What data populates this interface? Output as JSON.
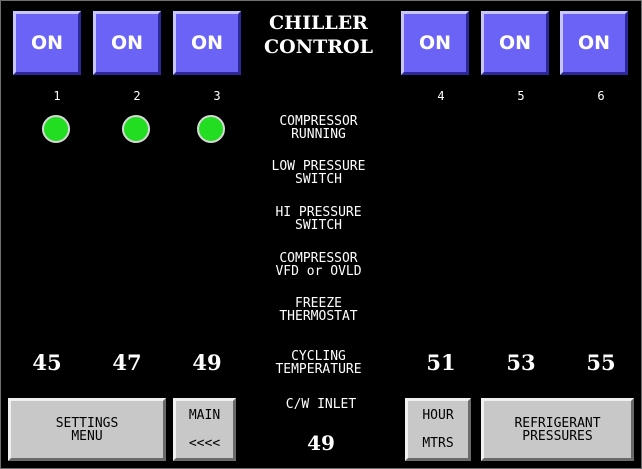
{
  "title_line1": "CHILLER",
  "title_line2": "CONTROL",
  "compressors": [
    {
      "button": "ON",
      "number": "1",
      "running": true,
      "temp": "45"
    },
    {
      "button": "ON",
      "number": "2",
      "running": true,
      "temp": "47"
    },
    {
      "button": "ON",
      "number": "3",
      "running": true,
      "temp": "49"
    },
    {
      "button": "ON",
      "number": "4",
      "running": false,
      "temp": "51"
    },
    {
      "button": "ON",
      "number": "5",
      "running": false,
      "temp": "53"
    },
    {
      "button": "ON",
      "number": "6",
      "running": false,
      "temp": "55"
    }
  ],
  "labels": {
    "compressor_running": [
      "COMPRESSOR",
      "RUNNING"
    ],
    "low_pressure": [
      "LOW PRESSURE",
      "SWITCH"
    ],
    "hi_pressure": [
      "HI PRESSURE",
      "SWITCH"
    ],
    "vfd_ovld": [
      "COMPRESSOR",
      "VFD or OVLD"
    ],
    "freeze": [
      "FREEZE",
      "THERMOSTAT"
    ],
    "cycling": [
      "CYCLING",
      "TEMPERATURE"
    ]
  },
  "cw_inlet": {
    "label": "C/W INLET",
    "value": "49"
  },
  "buttons": {
    "settings": [
      "SETTINGS",
      "MENU"
    ],
    "main": [
      "MAIN",
      "<<<<"
    ],
    "hour": [
      "HOUR",
      "MTRS"
    ],
    "refrigerant": [
      "REFRIGERANT",
      "PRESSURES"
    ]
  },
  "colors": {
    "on_button": "#6b63f6",
    "led_running": "#22dd22",
    "gray_button": "#c8c8c8"
  }
}
